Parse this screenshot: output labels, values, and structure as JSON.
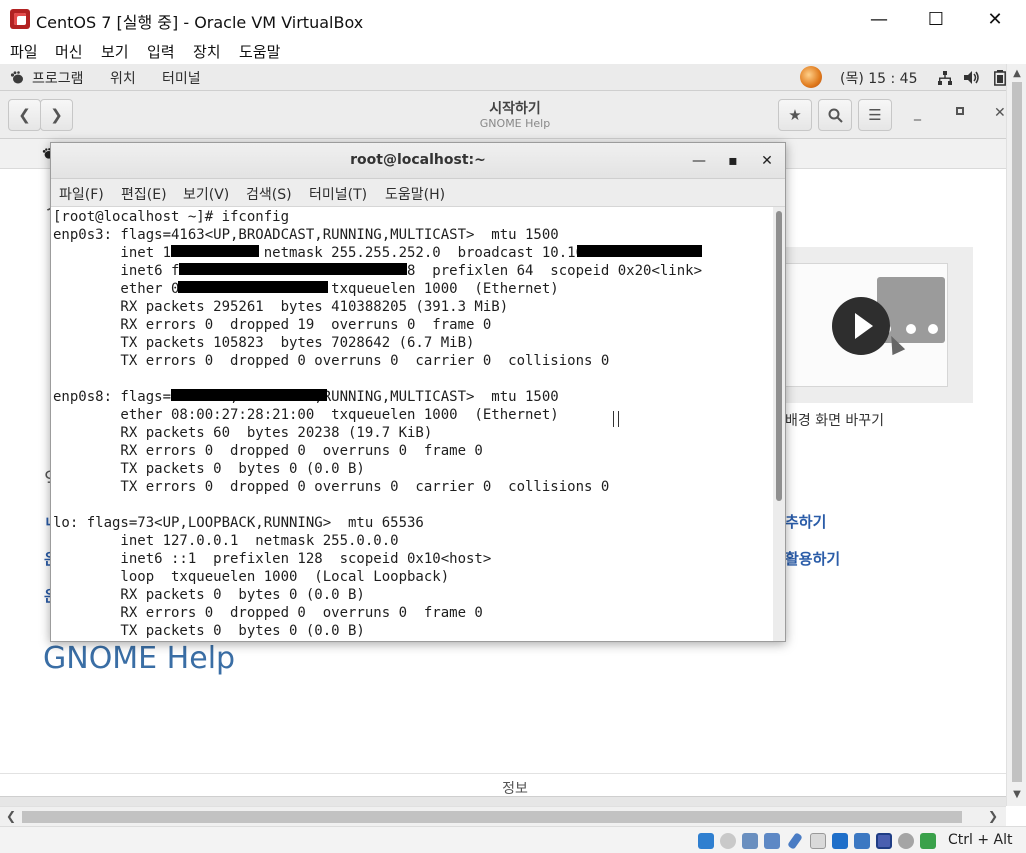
{
  "vbox": {
    "title": "CentOS 7 [실행 중] - Oracle VM VirtualBox",
    "menu": [
      "파일",
      "머신",
      "보기",
      "입력",
      "장치",
      "도움말"
    ],
    "host_key": "Ctrl + Alt"
  },
  "gnome_top": {
    "apps": "프로그램",
    "places": "위치",
    "terminal": "터미널",
    "clock": "(목) 15 : 45"
  },
  "help": {
    "title": "시작하기",
    "subtitle": "GNOME Help",
    "video_caption": "배경 화면 바꾸기",
    "link_1": "추하기",
    "link_2": "활용하기",
    "big_title": "GNOME Help",
    "footer": "정보",
    "left_fragments": [
      "ㅅ",
      "ㄴ",
      "은",
      "은",
      "익"
    ]
  },
  "terminal": {
    "title": "root@localhost:~",
    "menu": [
      "파일(F)",
      "편집(E)",
      "보기(V)",
      "검색(S)",
      "터미널(T)",
      "도움말(H)"
    ],
    "lines": [
      "[root@localhost ~]# ifconfig",
      "enp0s3: flags=4163<UP,BROADCAST,RUNNING,MULTICAST>  mtu 1500",
      "        inet 10.10.8.52  netmask 255.255.252.0  broadcast 10.10.11.255",
      "        inet6 fe80::a00:27ff:fe4d:da0f:5898  prefixlen 64  scopeid 0x20<link>",
      "        ether 08:00:27:4d:02:0a  txqueuelen 1000  (Ethernet)",
      "        RX packets 295261  bytes 410388205 (391.3 MiB)",
      "        RX errors 0  dropped 19  overruns 0  frame 0",
      "        TX packets 105823  bytes 7028642 (6.7 MiB)",
      "        TX errors 0  dropped 0 overruns 0  carrier 0  collisions 0",
      "",
      "enp0s8: flags=4163<UP,BROADCAST,RUNNING,MULTICAST>  mtu 1500",
      "        ether 08:00:27:28:21:00  txqueuelen 1000  (Ethernet)",
      "        RX packets 60  bytes 20238 (19.7 KiB)",
      "        RX errors 0  dropped 0  overruns 0  frame 0",
      "        TX packets 0  bytes 0 (0.0 B)",
      "        TX errors 0  dropped 0 overruns 0  carrier 0  collisions 0",
      "",
      "lo: flags=73<UP,LOOPBACK,RUNNING>  mtu 65536",
      "        inet 127.0.0.1  netmask 255.0.0.0",
      "        inet6 ::1  prefixlen 128  scopeid 0x10<host>",
      "        loop  txqueuelen 1000  (Local Loopback)",
      "        RX packets 0  bytes 0 (0.0 B)",
      "        RX errors 0  dropped 0  overruns 0  frame 0",
      "        TX packets 0  bytes 0 (0.0 B)"
    ]
  }
}
